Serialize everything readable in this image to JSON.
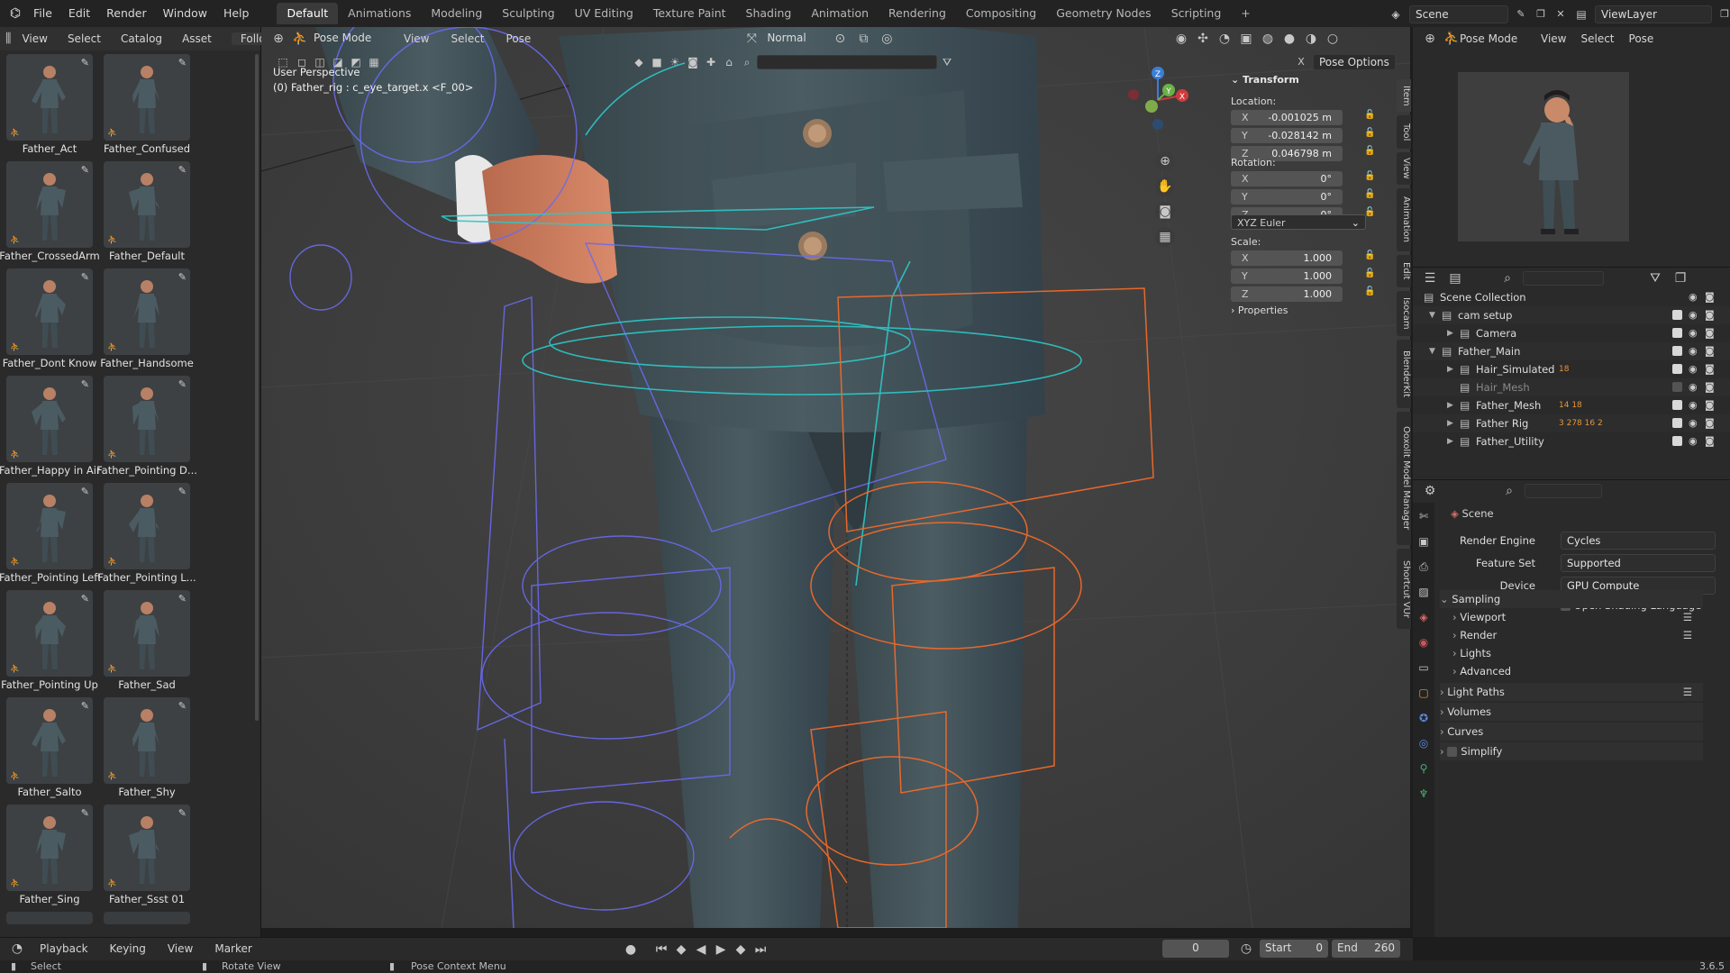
{
  "topbar": {
    "menus": [
      "File",
      "Edit",
      "Render",
      "Window",
      "Help"
    ],
    "workspaces": [
      "Default",
      "Animations",
      "Modeling",
      "Sculpting",
      "UV Editing",
      "Texture Paint",
      "Shading",
      "Animation",
      "Rendering",
      "Compositing",
      "Geometry Nodes",
      "Scripting"
    ],
    "active_workspace": "Default",
    "add_tab": "+",
    "scene": "Scene",
    "view_layer": "ViewLayer"
  },
  "asset_browser": {
    "menus": [
      "View",
      "Select",
      "Catalog",
      "Asset"
    ],
    "follow": "Follow",
    "assets": [
      "Father_Act",
      "Father_Confused",
      "Father_CrossedArm",
      "Father_Default",
      "Father_Dont Know",
      "Father_Handsome",
      "Father_Happy in Air",
      "Father_Pointing D...",
      "Father_Pointing Left",
      "Father_Pointing L...",
      "Father_Pointing Up",
      "Father_Sad",
      "Father_Salto",
      "Father_Shy",
      "Father_Sing",
      "Father_Ssst 01"
    ]
  },
  "viewport": {
    "mode": "Pose Mode",
    "menus": [
      "View",
      "Select",
      "Pose"
    ],
    "orientation": "Normal",
    "pose_options": "Pose Options",
    "perspective": "User Perspective",
    "active_bone": "(0) Father_rig : c_eye_target.x <F_00>",
    "gizmo_axes": [
      "X",
      "Y",
      "Z"
    ]
  },
  "transform_panel": {
    "title": "Transform",
    "location_label": "Location:",
    "location": [
      {
        "axis": "X",
        "value": "-0.001025 m"
      },
      {
        "axis": "Y",
        "value": "-0.028142 m"
      },
      {
        "axis": "Z",
        "value": "0.046798 m"
      }
    ],
    "rotation_label": "Rotation:",
    "rotation": [
      {
        "axis": "X",
        "value": "0°"
      },
      {
        "axis": "Y",
        "value": "0°"
      },
      {
        "axis": "Z",
        "value": "0°"
      }
    ],
    "rotation_mode": "XYZ Euler",
    "scale_label": "Scale:",
    "scale": [
      {
        "axis": "X",
        "value": "1.000"
      },
      {
        "axis": "Y",
        "value": "1.000"
      },
      {
        "axis": "Z",
        "value": "1.000"
      }
    ],
    "properties": "Properties"
  },
  "sidebar_tabs": [
    "Item",
    "Tool",
    "View",
    "Animation",
    "Edit",
    "Isocam",
    "BlenderKit",
    "Ooxolit Model Manager",
    "Shortcut VUr"
  ],
  "preview_header": {
    "mode": "Pose Mode",
    "menus": [
      "View",
      "Select",
      "Pose"
    ]
  },
  "outliner": {
    "rows": [
      {
        "label": "Scene Collection",
        "indent": 0
      },
      {
        "label": "cam setup",
        "indent": 1
      },
      {
        "label": "Camera",
        "indent": 2
      },
      {
        "label": "Father_Main",
        "indent": 1
      },
      {
        "label": "Hair_Simulated",
        "indent": 2,
        "badge": "18"
      },
      {
        "label": "Hair_Mesh",
        "indent": 2
      },
      {
        "label": "Father_Mesh",
        "indent": 2,
        "badge": "14 18"
      },
      {
        "label": "Father Rig",
        "indent": 2,
        "badge": "3 278 16 2"
      },
      {
        "label": "Father_Utility",
        "indent": 2
      }
    ]
  },
  "properties": {
    "context": "Scene",
    "render_engine_label": "Render Engine",
    "render_engine": "Cycles",
    "feature_set_label": "Feature Set",
    "feature_set": "Supported",
    "device_label": "Device",
    "device": "GPU Compute",
    "osl": "Open Shading Language",
    "sections": [
      "Sampling",
      "Viewport",
      "Render",
      "Lights",
      "Advanced",
      "Light Paths",
      "Volumes",
      "Curves",
      "Simplify"
    ]
  },
  "timeline": {
    "menus": [
      "Playback",
      "Keying",
      "View",
      "Marker"
    ],
    "current_frame": "0",
    "start_label": "Start",
    "start": "0",
    "end_label": "End",
    "end": "260"
  },
  "statusbar": {
    "select": "Select",
    "rotate": "Rotate View",
    "context": "Pose Context Menu",
    "version": "3.6.5"
  }
}
